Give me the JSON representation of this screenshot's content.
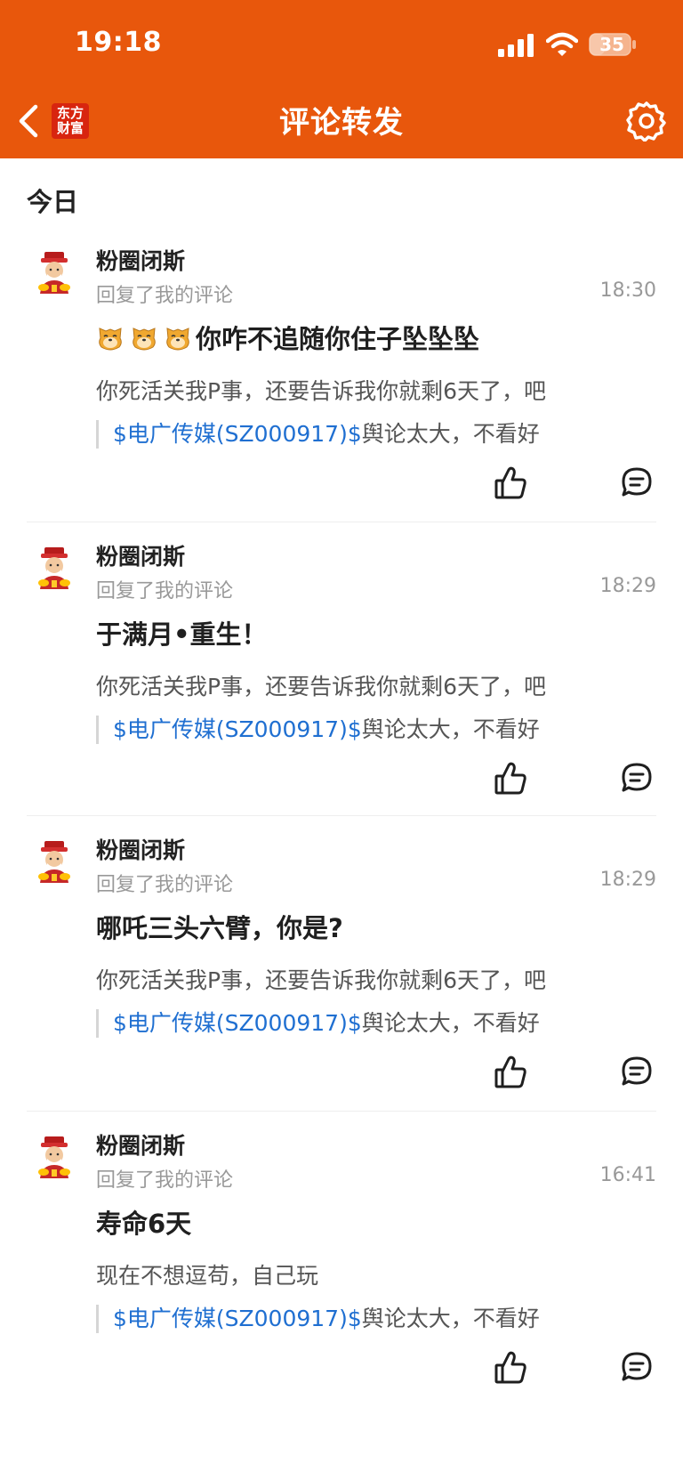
{
  "status_bar": {
    "time": "19:18",
    "battery": "35"
  },
  "header": {
    "title": "评论转发",
    "logo_line1": "东方",
    "logo_line2": "财富"
  },
  "section": {
    "title": "今日"
  },
  "colors": {
    "header_bg": "#e8570c",
    "link": "#1f6fd1",
    "muted": "#999999"
  },
  "items": [
    {
      "user": "粉圈闭斯",
      "action": "回复了我的评论",
      "time": "18:30",
      "emoji_count": 3,
      "emoji_icon": "dog-face-icon",
      "reply": "你咋不追随你住子坠坠坠",
      "original": "你死活关我P事，还要告诉我你就剩6天了，吧",
      "stock": "$电广传媒(SZ000917)$",
      "quote": "舆论太大，不看好"
    },
    {
      "user": "粉圈闭斯",
      "action": "回复了我的评论",
      "time": "18:29",
      "emoji_count": 0,
      "reply": "于满月•重生！",
      "original": "你死活关我P事，还要告诉我你就剩6天了，吧",
      "stock": "$电广传媒(SZ000917)$",
      "quote": "舆论太大，不看好"
    },
    {
      "user": "粉圈闭斯",
      "action": "回复了我的评论",
      "time": "18:29",
      "emoji_count": 0,
      "reply": "哪吒三头六臂，你是?",
      "original": "你死活关我P事，还要告诉我你就剩6天了，吧",
      "stock": "$电广传媒(SZ000917)$",
      "quote": "舆论太大，不看好"
    },
    {
      "user": "粉圈闭斯",
      "action": "回复了我的评论",
      "time": "16:41",
      "emoji_count": 0,
      "reply": "寿命6天",
      "original": "现在不想逗苟，自己玩",
      "stock": "$电广传媒(SZ000917)$",
      "quote": "舆论太大，不看好"
    }
  ]
}
